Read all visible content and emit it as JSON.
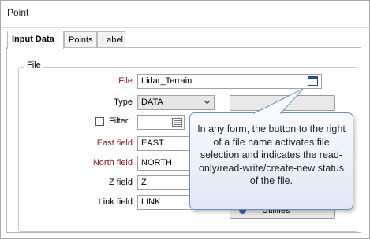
{
  "window": {
    "title": "Point"
  },
  "tabs": [
    {
      "label": "Input Data",
      "active": true
    },
    {
      "label": "Points",
      "active": false
    },
    {
      "label": "Label",
      "active": false
    }
  ],
  "group": {
    "label": "File"
  },
  "form": {
    "file": {
      "label": "File",
      "value": "Lidar_Terrain"
    },
    "type": {
      "label": "Type",
      "value": "DATA"
    },
    "filter": {
      "label": "Filter",
      "value": ""
    },
    "east": {
      "label": "East field",
      "value": "EAST"
    },
    "north": {
      "label": "North field",
      "value": "NORTH"
    },
    "z": {
      "label": "Z field",
      "value": "Z"
    },
    "link": {
      "label": "Link field",
      "value": "LINK"
    }
  },
  "buttons": {
    "utilities": "Utilities"
  },
  "tooltip": {
    "text": "In any form, the button to the right of a file name activates file selection and indicates the read-only/read-write/create-new status of the file."
  },
  "colors": {
    "required_label": "#7a1a1a",
    "tooltip_border": "#6f8fc3"
  }
}
